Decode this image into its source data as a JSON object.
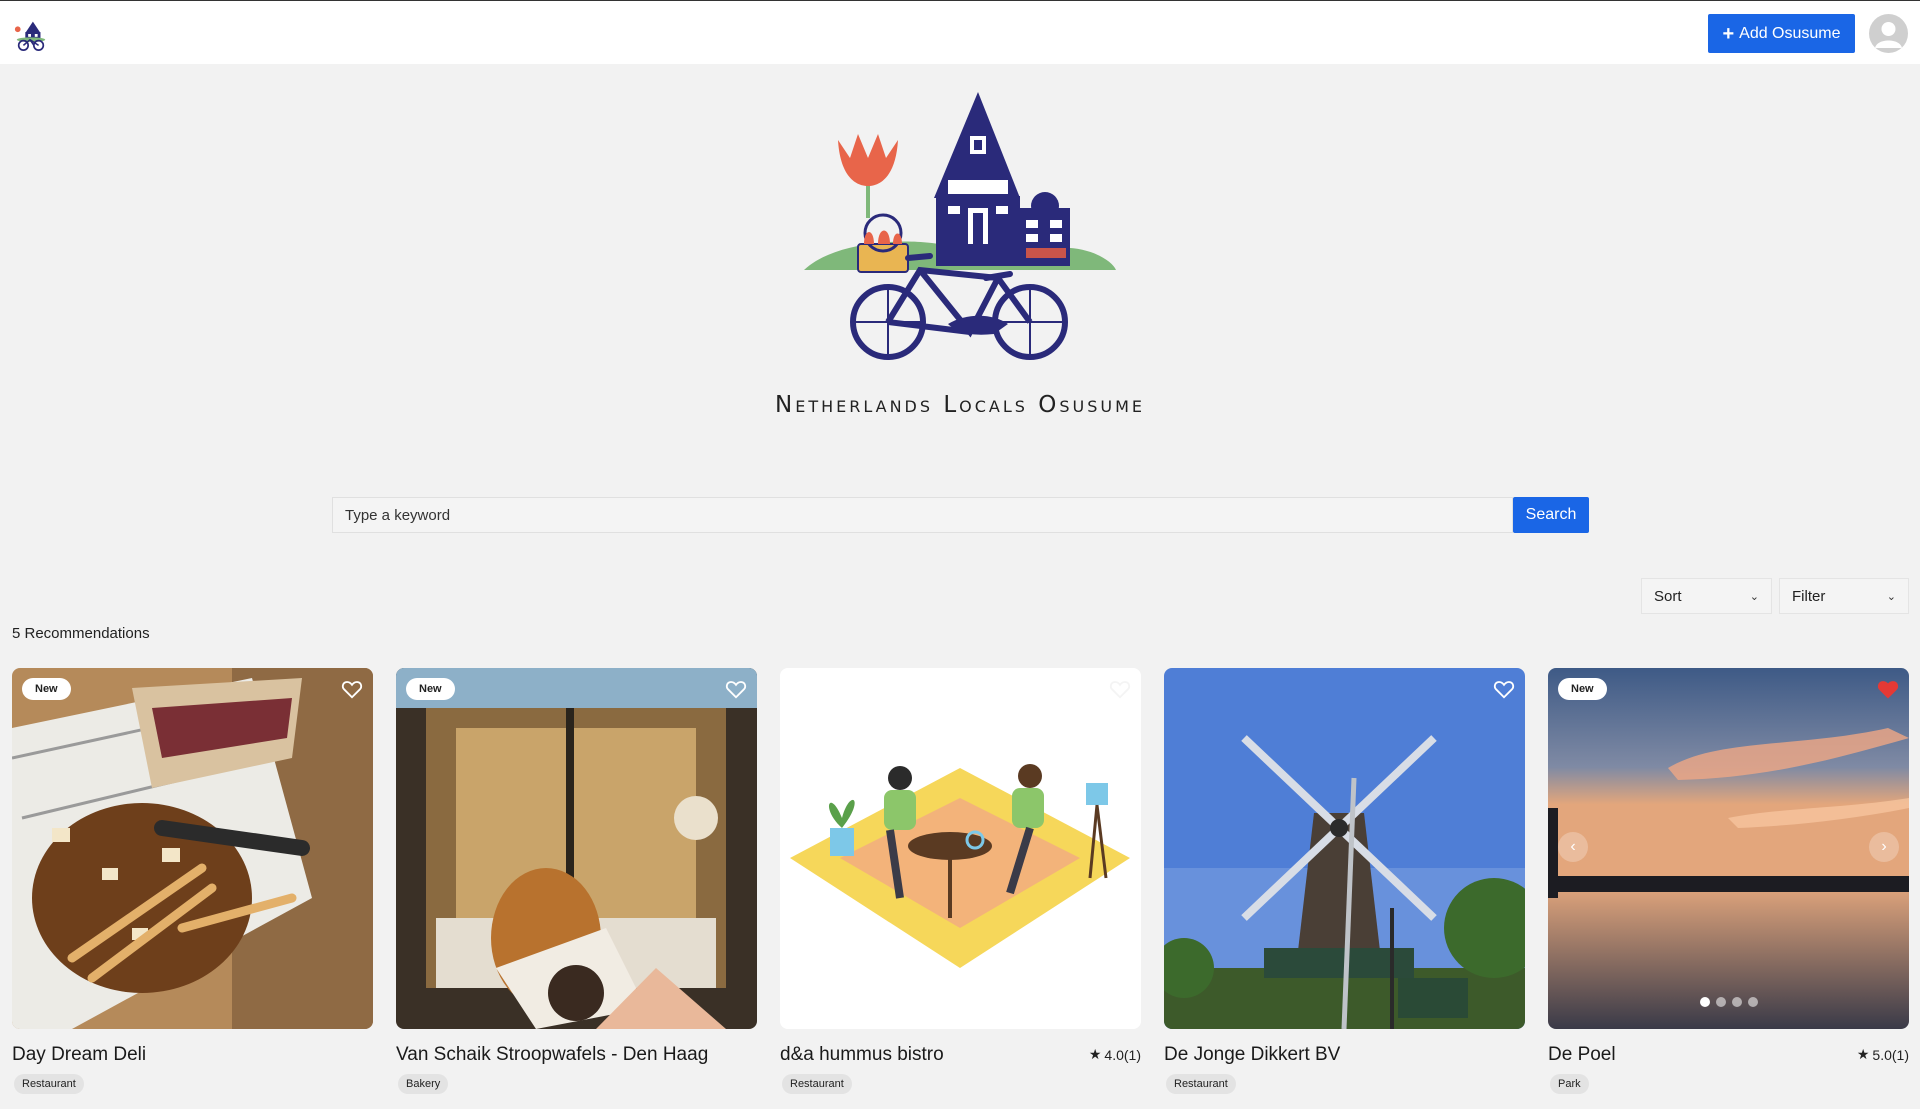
{
  "header": {
    "add_label": "Add Osusume",
    "icons": {
      "add": "plus-icon",
      "account": "user-avatar-icon",
      "logo": "house-bicycle-logo"
    }
  },
  "hero": {
    "title": "Netherlands Locals Osusume"
  },
  "search": {
    "placeholder": "Type a keyword",
    "button_label": "Search"
  },
  "controls": {
    "sort_label": "Sort",
    "filter_label": "Filter"
  },
  "results": {
    "count_text": "5 Recommendations"
  },
  "cards": [
    {
      "name": "Day Dream Deli",
      "tag": "Restaurant",
      "badge": "New",
      "rating": "",
      "favorited": false
    },
    {
      "name": "Van Schaik Stroopwafels - Den Haag",
      "tag": "Bakery",
      "badge": "New",
      "rating": "",
      "favorited": false
    },
    {
      "name": "d&a hummus bistro",
      "tag": "Restaurant",
      "badge": "",
      "rating": "4.0(1)",
      "favorited": false
    },
    {
      "name": "De Jonge Dikkert BV",
      "tag": "Restaurant",
      "badge": "",
      "rating": "",
      "favorited": false
    },
    {
      "name": "De Poel",
      "tag": "Park",
      "badge": "New",
      "rating": "5.0(1)",
      "favorited": true,
      "photo_count": 4,
      "active_photo": 1
    }
  ],
  "colors": {
    "accent": "#1a66e6",
    "heart_active": "#e53935",
    "logo_navy": "#2a2a7a",
    "tulip": "#e8654a"
  }
}
